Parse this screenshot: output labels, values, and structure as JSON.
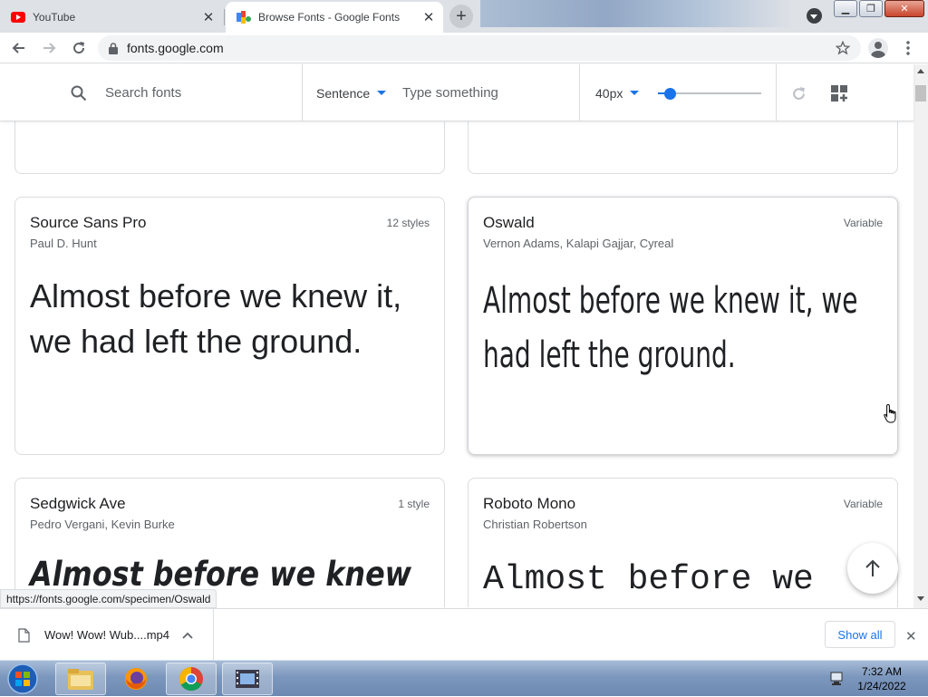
{
  "browser": {
    "tabs": [
      {
        "title": "YouTube",
        "active": false
      },
      {
        "title": "Browse Fonts - Google Fonts",
        "active": true
      }
    ],
    "url": "fonts.google.com",
    "status_link": "https://fonts.google.com/specimen/Oswald"
  },
  "toolbar": {
    "search_placeholder": "Search fonts",
    "preview_mode": "Sentence",
    "preview_placeholder": "Type something",
    "font_size": "40px",
    "font_size_slider": 0.1
  },
  "cards": [
    {
      "name": "Source Sans Pro",
      "author": "Paul D. Hunt",
      "styles": "12 styles",
      "sample": "Almost before we knew it, we had left the ground."
    },
    {
      "name": "Oswald",
      "author": "Vernon Adams, Kalapi Gajjar, Cyreal",
      "styles": "Variable",
      "sample": "Almost before we knew it, we had left the ground."
    },
    {
      "name": "Sedgwick Ave",
      "author": "Pedro Vergani, Kevin Burke",
      "styles": "1 style",
      "sample": "Almost before we knew it, we had left the ground."
    },
    {
      "name": "Roboto Mono",
      "author": "Christian Robertson",
      "styles": "Variable",
      "sample": "Almost before we knew it, we had left the ground."
    }
  ],
  "downloads": {
    "file": "Wow! Wow! Wub....mp4",
    "show_all": "Show all"
  },
  "taskbar": {
    "time": "7:32 AM",
    "date": "1/24/2022"
  },
  "colors": {
    "accent": "#1a73e8",
    "text": "#202124",
    "muted": "#5f6368"
  }
}
